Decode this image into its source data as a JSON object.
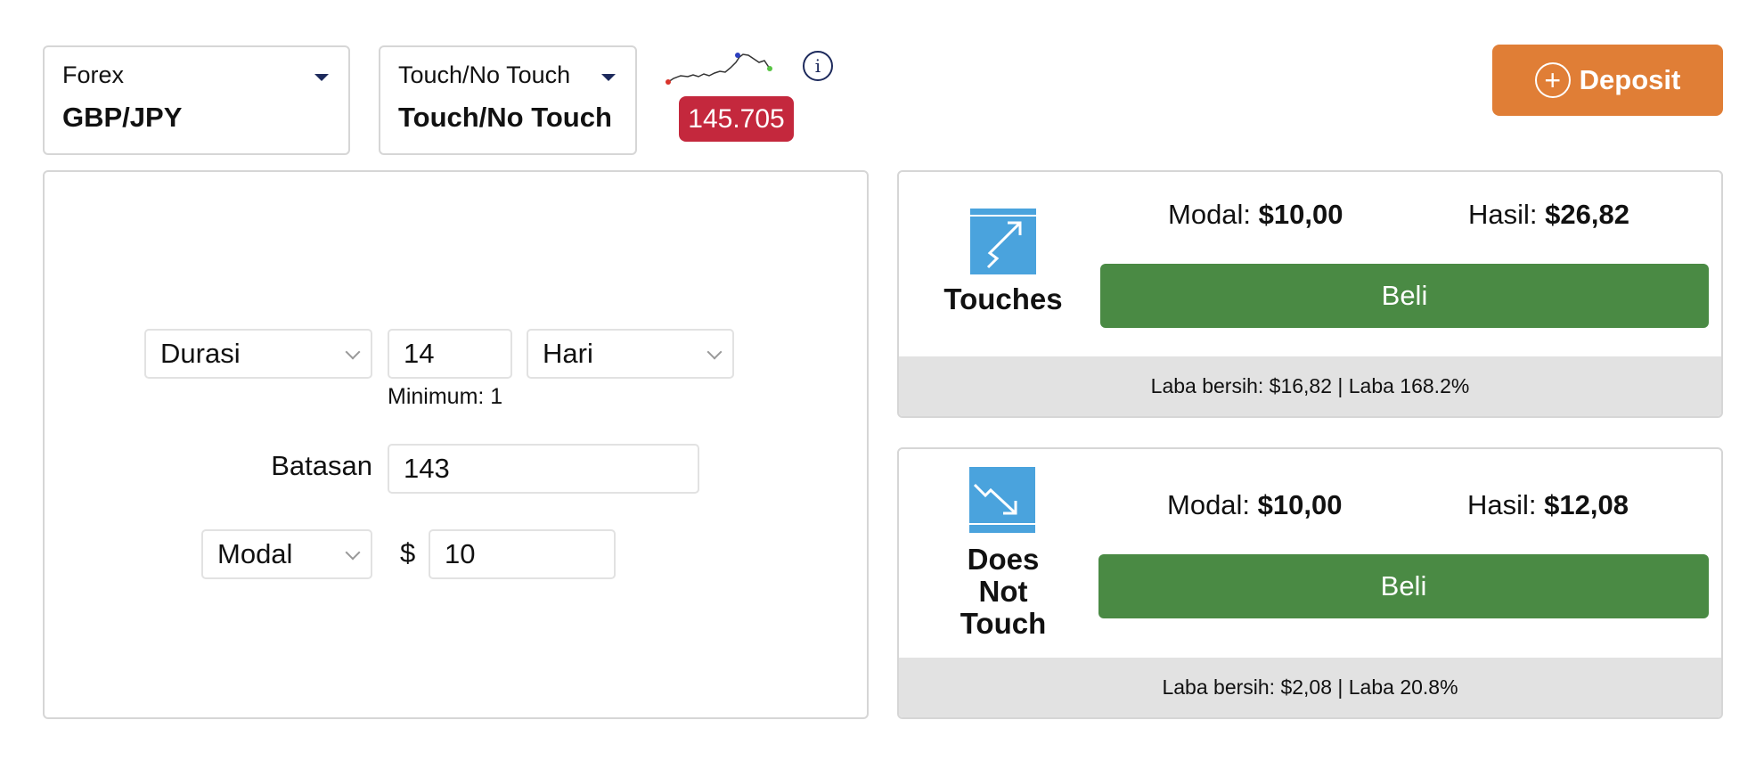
{
  "header": {
    "market_selector": {
      "category": "Forex",
      "value": "GBP/JPY"
    },
    "type_selector": {
      "category": "Touch/No Touch",
      "value": "Touch/No Touch"
    },
    "spot_price": "145.705",
    "deposit_label": "Deposit",
    "colors": {
      "price_badge": "#c4283d",
      "deposit": "#e07e36",
      "accent": "#1d2a5c"
    }
  },
  "form": {
    "duration_type": "Durasi",
    "duration_value": "14",
    "duration_unit": "Hari",
    "duration_hint": "Minimum: 1",
    "barrier_label": "Batasan",
    "barrier_value": "143",
    "amount_type": "Modal",
    "currency_symbol": "$",
    "amount_value": "10"
  },
  "contracts": [
    {
      "name": "Touches",
      "icon": "trend-up-touch-icon",
      "stake_label": "Modal:",
      "stake_value": "$10,00",
      "payout_label": "Hasil:",
      "payout_value": "$26,82",
      "buy_label": "Beli",
      "footer": "Laba bersih: $16,82 | Laba 168.2%"
    },
    {
      "name": "Does Not Touch",
      "name_lines": [
        "Does",
        "Not",
        "Touch"
      ],
      "icon": "trend-down-no-touch-icon",
      "stake_label": "Modal:",
      "stake_value": "$10,00",
      "payout_label": "Hasil:",
      "payout_value": "$12,08",
      "buy_label": "Beli",
      "footer": "Laba bersih: $2,08 | Laba 20.8%"
    }
  ],
  "colors": {
    "buy_button": "#4a8a44",
    "icon_bg": "#4aa3dd",
    "footer_bg": "#e2e2e2"
  }
}
